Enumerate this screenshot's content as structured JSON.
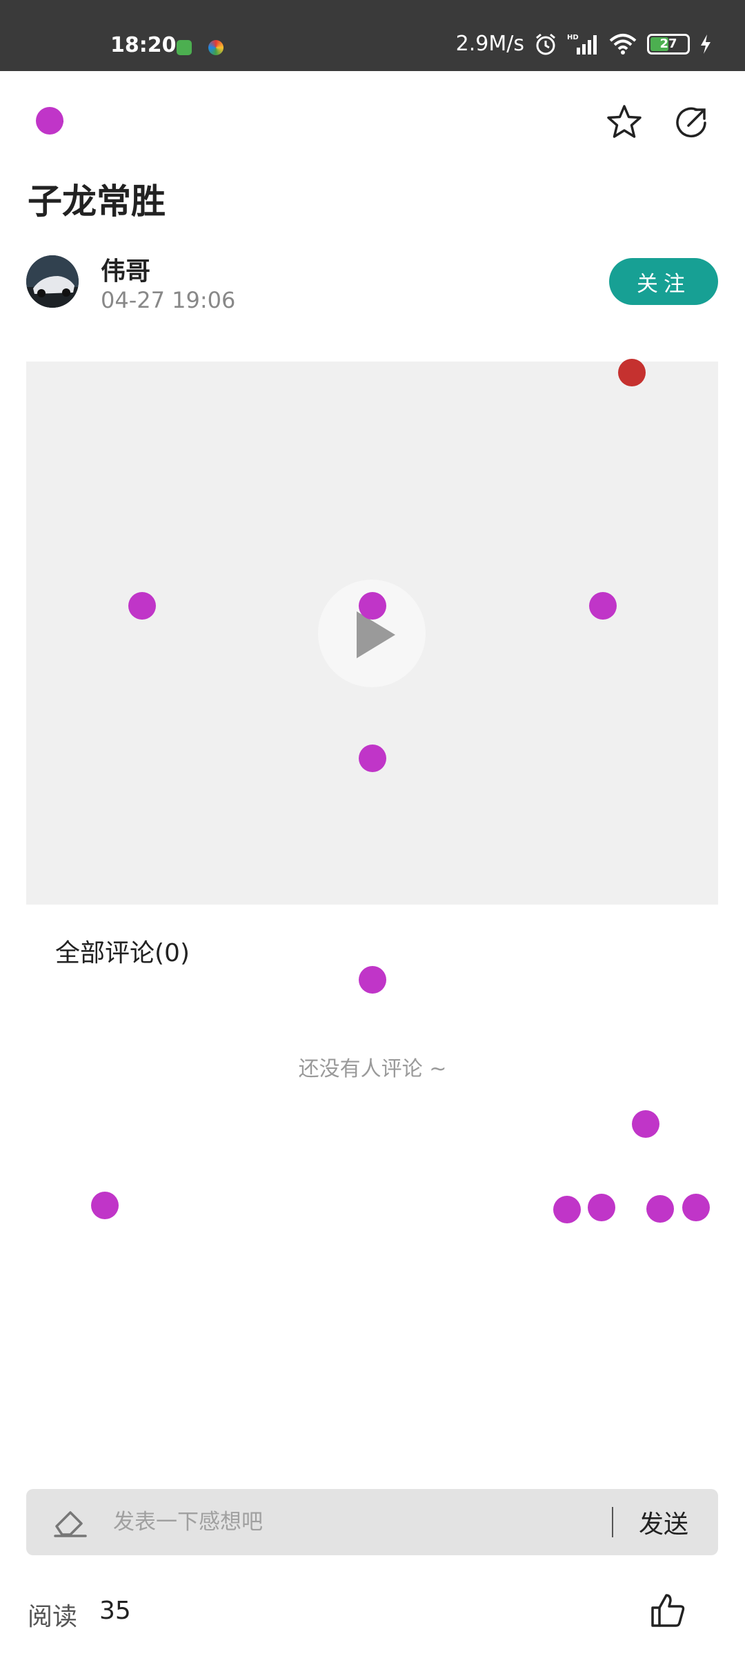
{
  "status_bar": {
    "time": "18:20",
    "network_speed": "2.9M/s",
    "battery": "27",
    "icons": [
      "alarm-icon",
      "signal-icon",
      "wifi-icon",
      "battery-icon",
      "charging-icon"
    ]
  },
  "nav": {
    "back_icon": "back-arrow-icon",
    "favorite_icon": "star-icon",
    "share_icon": "share-icon"
  },
  "post": {
    "title": "子龙常胜",
    "author": "伟哥",
    "date": "04-27 19:06",
    "follow_label": "关注"
  },
  "video": {
    "play_icon": "play-icon"
  },
  "comments": {
    "header": "全部评论(0)",
    "empty": "还没有人评论 ~"
  },
  "comment_bar": {
    "placeholder": "发表一下感想吧",
    "send_label": "发送"
  },
  "footer": {
    "reads_label": "阅读",
    "reads_count": "35",
    "like_icon": "thumbs-up-icon"
  },
  "colors": {
    "accent": "#17a094",
    "marker": "#c035c8",
    "marker_red": "#c5312f"
  }
}
